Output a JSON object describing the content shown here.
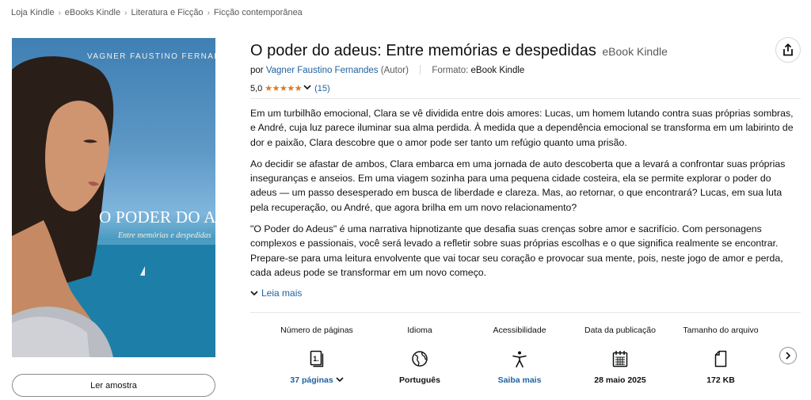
{
  "breadcrumb": [
    "Loja Kindle",
    "eBooks Kindle",
    "Literatura e Ficção",
    "Ficção contemporânea"
  ],
  "cover": {
    "author_text": "VAGNER FAUSTINO FERNANDES",
    "title_text": "O PODER DO ADEUS",
    "subtitle_text": "Entre memórias e despedidas"
  },
  "sample_button": "Ler amostra",
  "product": {
    "title": "O poder do adeus: Entre memórias e despedidas",
    "format_tag": "eBook Kindle",
    "by_prefix": "por",
    "author": "Vagner Faustino Fernandes",
    "author_role": "(Autor)",
    "format_label": "Formato:",
    "format_value": "eBook Kindle"
  },
  "rating": {
    "score": "5,0",
    "stars": "★★★★★",
    "count": "(15)",
    "value": 5.0
  },
  "description": {
    "paragraphs": [
      "Em um turbilhão emocional, Clara se vê dividida entre dois amores: Lucas, um homem lutando contra suas próprias sombras, e André, cuja luz parece iluminar sua alma perdida. À medida que a dependência emocional se transforma em um labirinto de dor e paixão, Clara descobre que o amor pode ser tanto um refúgio quanto uma prisão.",
      "Ao decidir se afastar de ambos, Clara embarca em uma jornada de auto descoberta que a levará a confrontar suas próprias inseguranças e anseios. Em uma viagem sozinha para uma pequena cidade costeira, ela se permite explorar o poder do adeus — um passo desesperado em busca de liberdade e clareza. Mas, ao retornar, o que encontrará? Lucas, em sua luta pela recuperação, ou André, que agora brilha em um novo relacionamento?",
      "\"O Poder do Adeus\" é uma narrativa hipnotizante que desafia suas crenças sobre amor e sacrifício. Com personagens complexos e passionais, você será levado a refletir sobre suas próprias escolhas e o que significa realmente se encontrar. Prepare-se para uma leitura envolvente que vai tocar seu coração e provocar sua mente, pois, neste jogo de amor e perda, cada adeus pode se transformar em um novo começo."
    ],
    "read_more": "Leia mais"
  },
  "details": [
    {
      "label": "Número de páginas",
      "icon": "book-pages-icon",
      "value": "37 páginas",
      "is_link": true
    },
    {
      "label": "Idioma",
      "icon": "globe-icon",
      "value": "Português",
      "is_link": false
    },
    {
      "label": "Acessibilidade",
      "icon": "accessibility-icon",
      "value": "Saiba mais",
      "is_link": true
    },
    {
      "label": "Data da publicação",
      "icon": "calendar-icon",
      "value": "28 maio 2025",
      "is_link": false
    },
    {
      "label": "Tamanho do arquivo",
      "icon": "file-icon",
      "value": "172 KB",
      "is_link": false
    }
  ],
  "colors": {
    "link": "#2162a1",
    "star": "#de7921",
    "text": "#0f1111",
    "muted": "#565959"
  }
}
